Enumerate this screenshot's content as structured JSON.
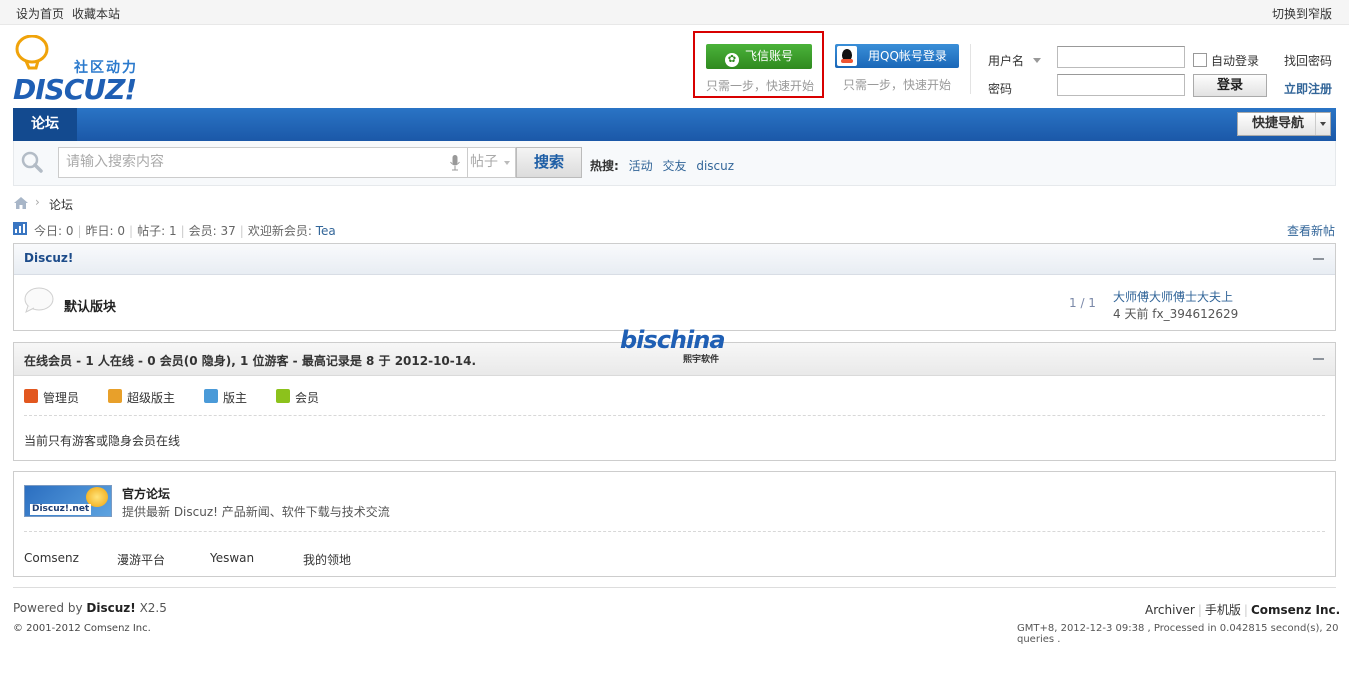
{
  "topbar": {
    "set_home": "设为首页",
    "bookmark": "收藏本站",
    "switch_width": "切换到窄版"
  },
  "logo": {
    "slogan": "社区动力",
    "wordmark": "DISCUZ!"
  },
  "third_party": {
    "feixin": {
      "label": "飞信账号",
      "tip": "只需一步，快速开始"
    },
    "qq": {
      "label": "用QQ帐号登录",
      "tip": "只需一步，快速开始"
    }
  },
  "login": {
    "username_label": "用户名",
    "password_label": "密码",
    "auto_login": "自动登录",
    "forgot": "找回密码",
    "register": "立即注册",
    "submit": "登录"
  },
  "nav": {
    "forum": "论坛",
    "quick_nav": "快捷导航"
  },
  "search": {
    "placeholder": "请输入搜索内容",
    "type": "帖子",
    "button": "搜索",
    "hot_label": "热搜:",
    "hot": [
      "活动",
      "交友",
      "discuz"
    ]
  },
  "breadcrumb": {
    "sep": "›",
    "current": "论坛"
  },
  "stats": {
    "today": "今日: 0",
    "yesterday": "昨日: 0",
    "posts": "帖子: 1",
    "members": "会员: 37",
    "welcome_label": "欢迎新会员:",
    "welcome_user": "Tea",
    "new_posts": "查看新帖"
  },
  "forum_group": {
    "title": "Discuz!",
    "forums": [
      {
        "name": "默认版块",
        "count": "1 / 1",
        "last_title": "大师傅大师傅士大夫上",
        "last_meta": "4 天前 fx_394612629"
      }
    ]
  },
  "online": {
    "summary": "在线会员 - 1 人在线 - 0 会员(0 隐身), 1 位游客 - 最高记录是 8 于 2012-10-14.",
    "legend": [
      "管理员",
      "超级版主",
      "版主",
      "会员"
    ],
    "legend_colors": [
      "#e2571f",
      "#e8a02a",
      "#4a9ad8",
      "#8cc21c"
    ],
    "none_text": "当前只有游客或隐身会员在线"
  },
  "watermark": {
    "brand": "bischina",
    "sub": "熙宇软件"
  },
  "links": {
    "official_logo": "Discuz!.net",
    "official_name": "官方论坛",
    "official_desc": "提供最新 Discuz! 产品新闻、软件下载与技术交流",
    "friends": [
      "Comsenz",
      "漫游平台",
      "Yeswan",
      "我的领地"
    ]
  },
  "footer": {
    "powered_prefix": "Powered by",
    "powered_brand": "Discuz!",
    "powered_version": "X2.5",
    "copyright": "© 2001-2012 Comsenz Inc.",
    "archiver": "Archiver",
    "mobile": "手机版",
    "company": "Comsenz Inc.",
    "info": "GMT+8, 2012-12-3 09:38 , Processed in 0.042815 second(s), 20 queries ."
  }
}
